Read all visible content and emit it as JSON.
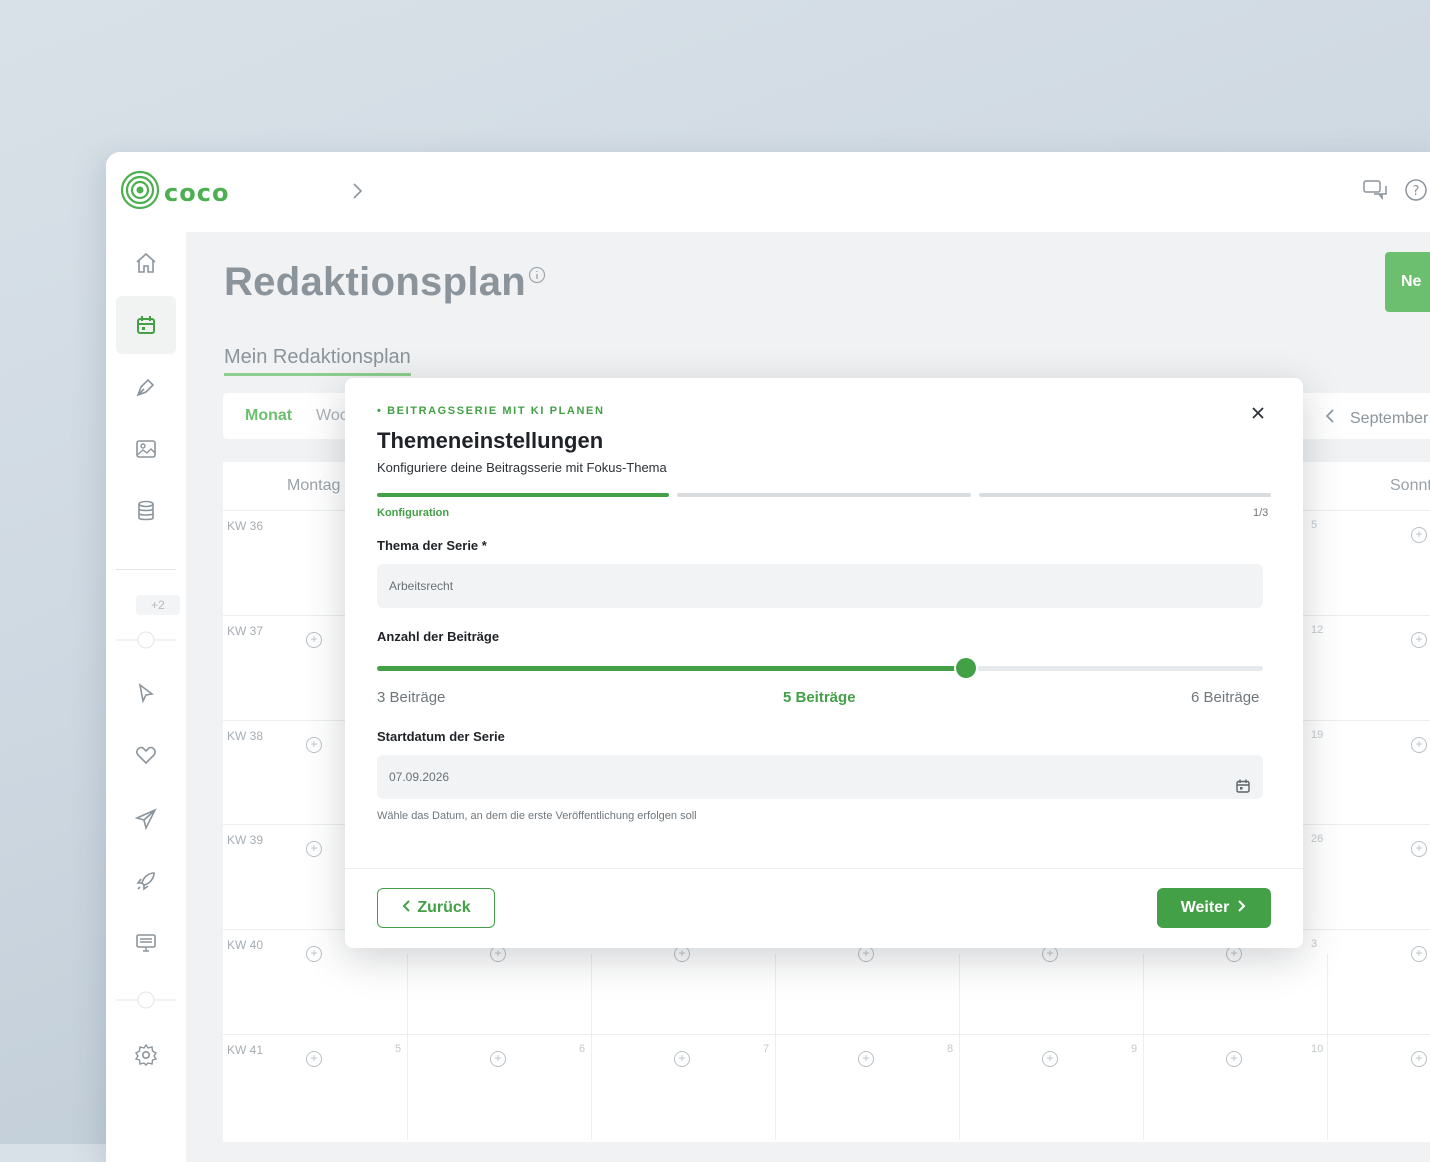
{
  "app": {
    "logo_text": "coco"
  },
  "header": {
    "page_title": "Redaktionsplan",
    "new_button_label": "Ne",
    "tab_label": "Mein Redaktionsplan"
  },
  "sidebar": {
    "badge": "+2"
  },
  "view_switch": {
    "month": "Monat",
    "week": "Woc",
    "current_month": "September"
  },
  "calendar": {
    "day_headers": [
      "Montag",
      "Sonnt"
    ],
    "weeks": [
      "KW 36",
      "KW 37",
      "KW 38",
      "KW 39",
      "KW 40",
      "KW 41"
    ],
    "sunday_numbers": [
      "5",
      "12",
      "19",
      "26",
      "3",
      "10"
    ],
    "kw41_days": [
      "5",
      "6",
      "7",
      "8",
      "9"
    ]
  },
  "modal": {
    "eyebrow": "• BEITRAGSSERIE MIT KI PLANEN",
    "title": "Themeneinstellungen",
    "subtitle": "Konfiguriere deine Beitragsserie mit Fokus-Thema",
    "step_label": "Konfiguration",
    "step_count": "1/3",
    "topic_label": "Thema der Serie *",
    "topic_value": "Arbeitsrecht",
    "count_label": "Anzahl der Beiträge",
    "slider": {
      "min_label": "3 Beiträge",
      "value_label": "5 Beiträge",
      "max_label": "6 Beiträge",
      "min": 3,
      "max": 6,
      "value": 5,
      "fill_fraction": 0.665
    },
    "start_label": "Startdatum der Serie",
    "start_value": "07.09.2026",
    "start_hint": "Wähle das Datum, an dem die erste Veröffentlichung erfolgen soll",
    "back_label": "Zurück",
    "next_label": "Weiter"
  },
  "colors": {
    "accent": "#43a047",
    "accent_light": "#6cbf6f",
    "muted": "#8b949b"
  }
}
